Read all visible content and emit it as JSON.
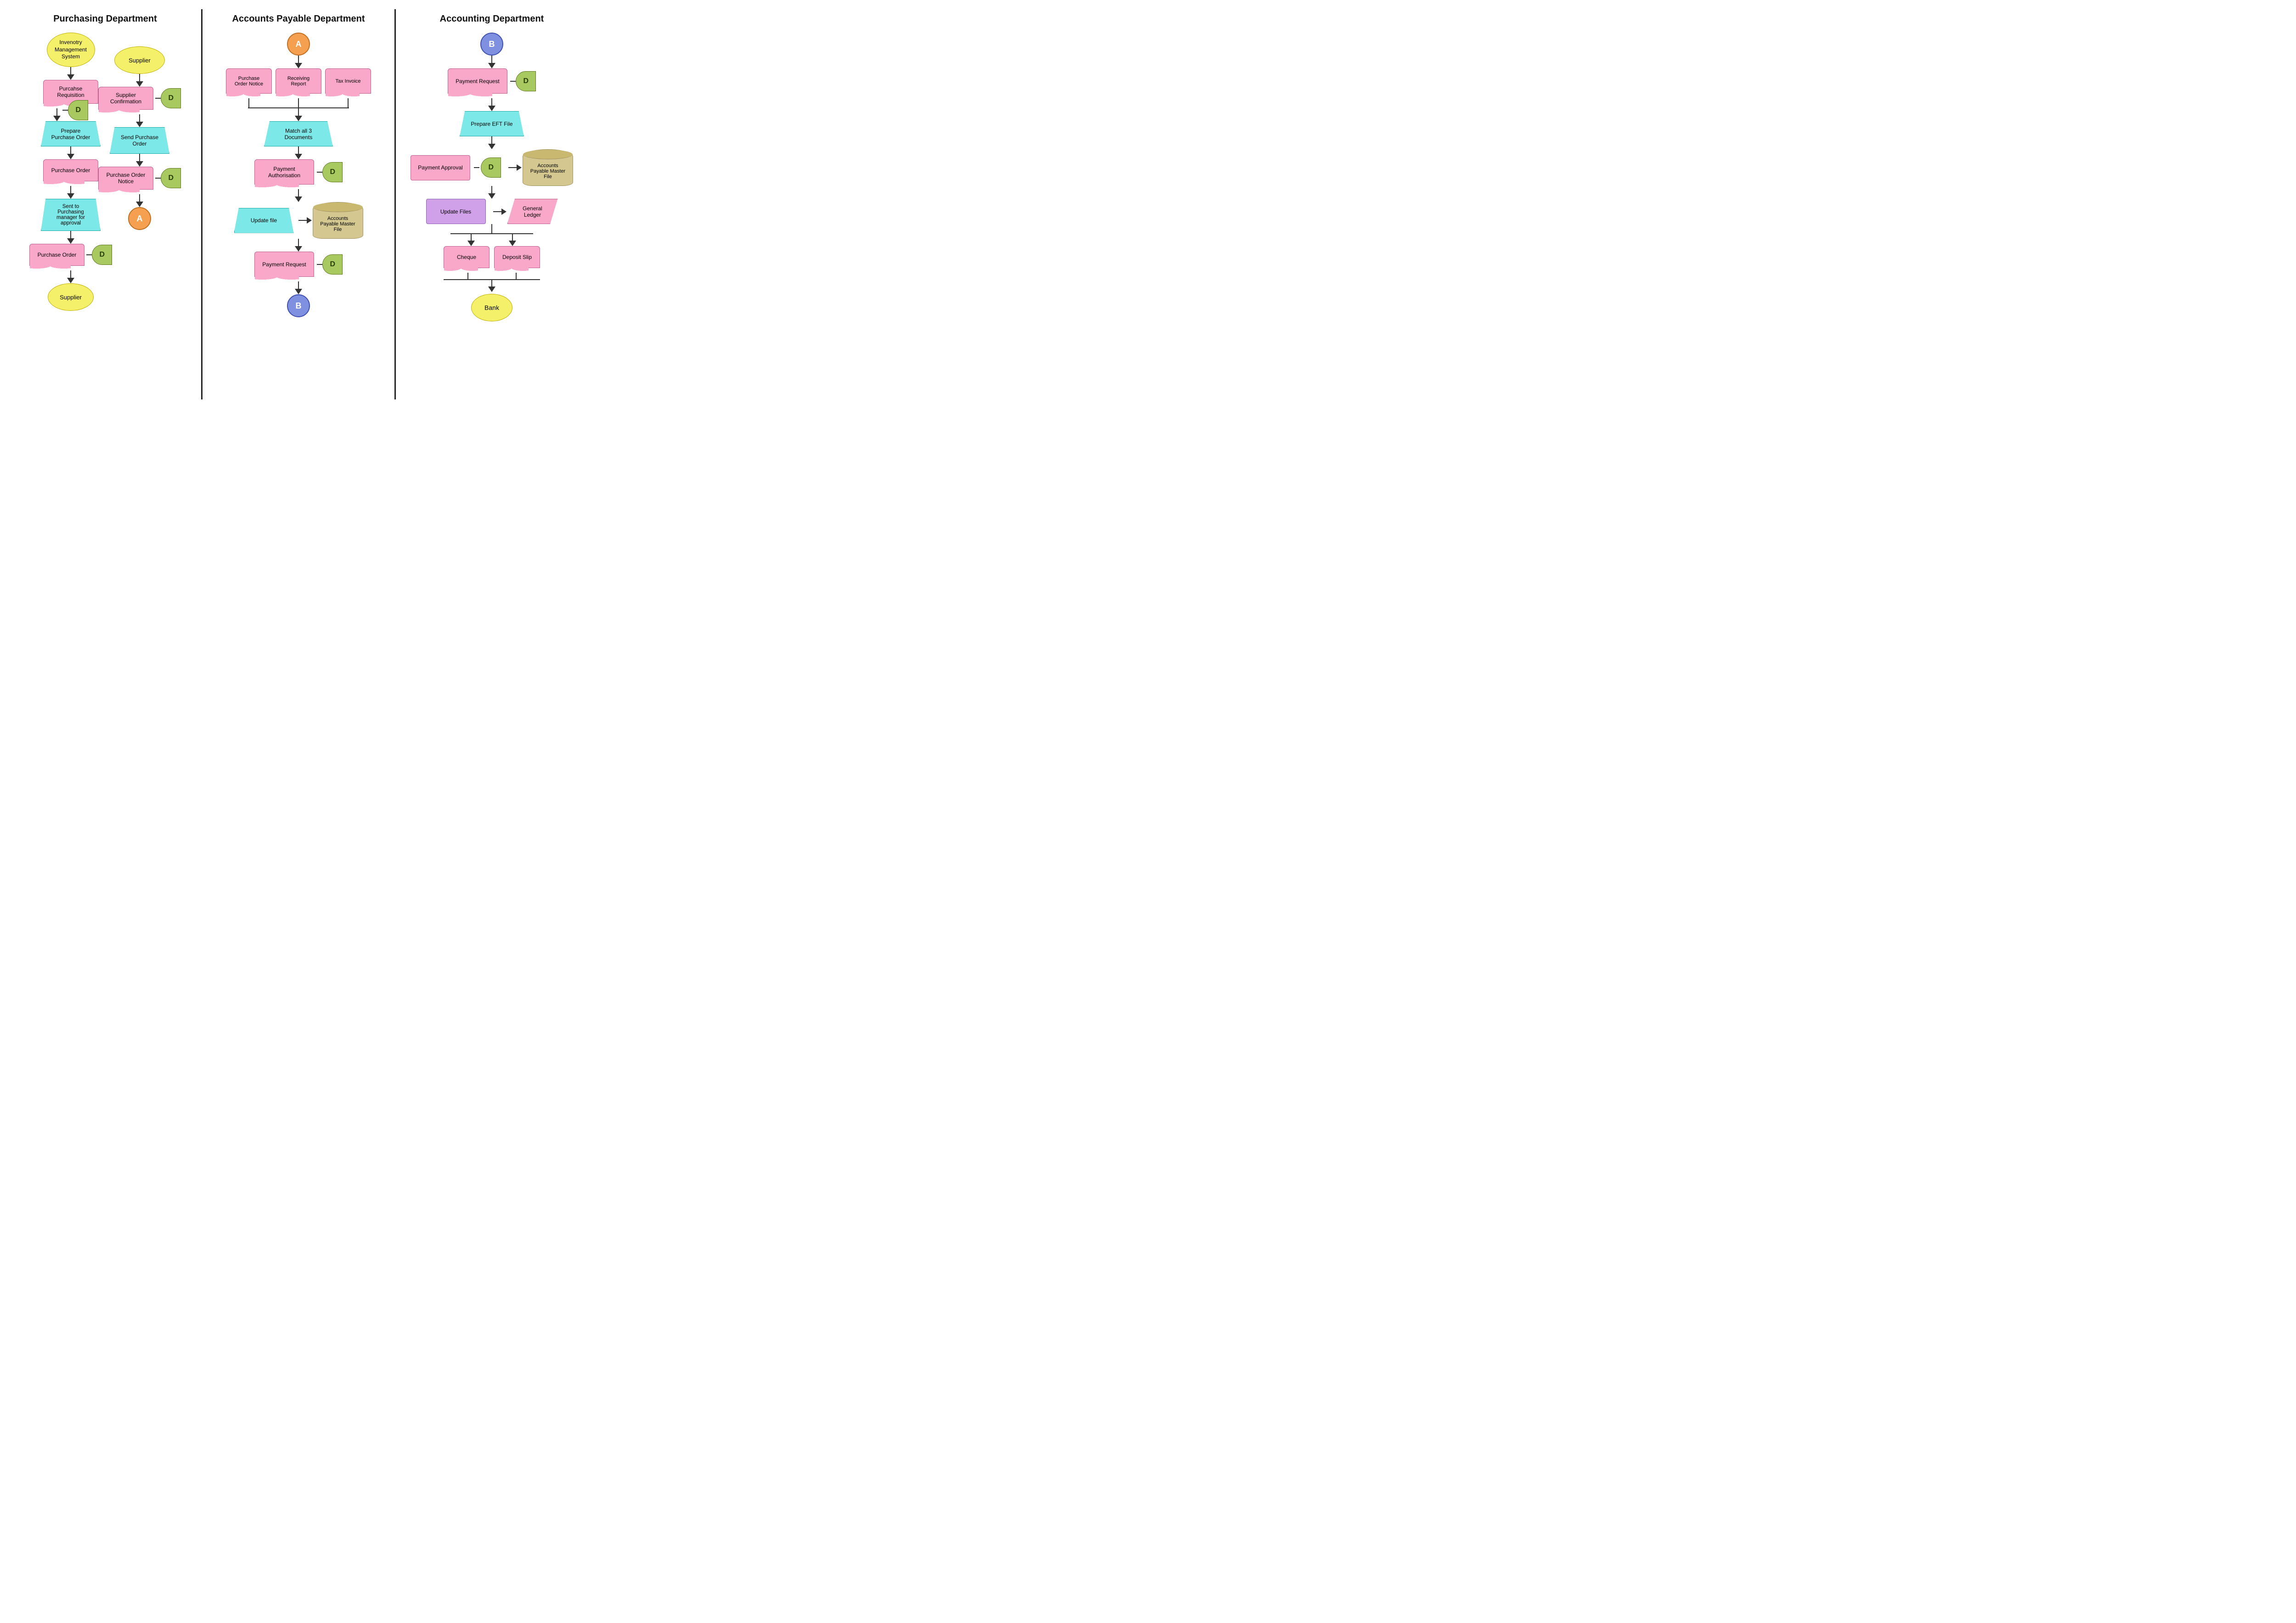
{
  "purchasing_dept": {
    "title": "Purchasing Department",
    "col_left": {
      "inventory": "Invenotry Management System",
      "purchase_req": "Purcahse Requisition",
      "prepare_po": "Prepare Purchase Order",
      "purchase_order1": "Purchase Order",
      "sent_approval": "Sent to Purchasing manager for approval",
      "purchase_order2": "Purchase Order",
      "supplier": "Supplier"
    },
    "col_right": {
      "supplier": "Supplier",
      "supplier_confirm": "Supplier Confirmation",
      "send_po": "Send Purchase Order",
      "po_notice": "Purchase Order Notice",
      "connector_a": "A"
    }
  },
  "ap_dept": {
    "title": "Accounts Payable Department",
    "connector_a": "A",
    "po_notice": "Purchase Order Notice",
    "receiving_report": "Receiving Report",
    "tax_invoice": "Tax Invoice",
    "match_docs": "Match all 3 Documents",
    "payment_auth": "Payment Authorisation",
    "update_file": "Update file",
    "ap_master": "Accounts Payable Master File",
    "payment_request": "Payment Request",
    "connector_b": "B"
  },
  "acc_dept": {
    "title": "Accounting Department",
    "connector_b": "B",
    "payment_request": "Payment Request",
    "prepare_eft": "Prepare EFT File",
    "payment_approval": "Payment Approval",
    "ap_master": "Accounts Payable Master File",
    "update_files": "Update Files",
    "general_ledger": "General Ledger",
    "cheque": "Cheque",
    "deposit_slip": "Deposit Slip",
    "bank": "Bank"
  },
  "d_label": "D"
}
